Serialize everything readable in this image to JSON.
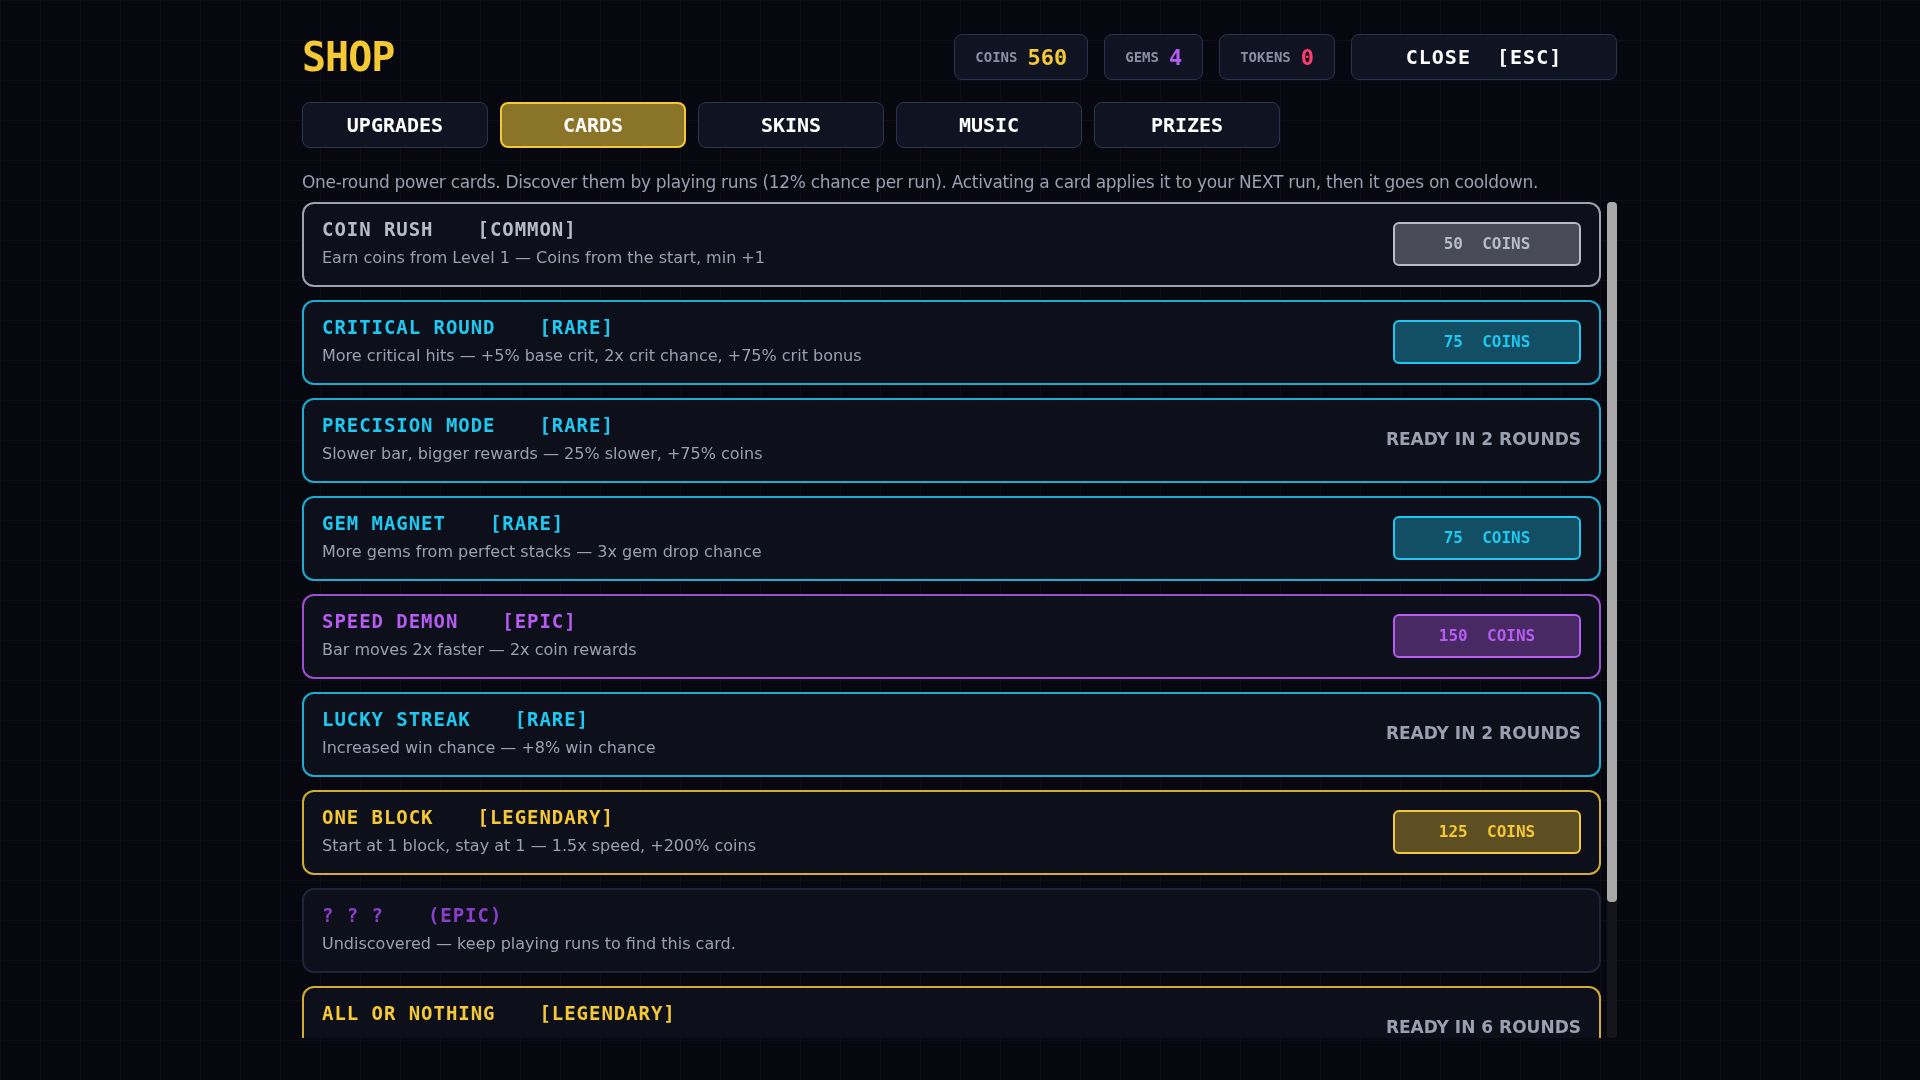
{
  "title": "SHOP",
  "currencies": [
    {
      "label": "COINS",
      "value": "560",
      "color": "#f5c935"
    },
    {
      "label": "GEMS",
      "value": "4",
      "color": "#b65cf0"
    },
    {
      "label": "TOKENS",
      "value": "0",
      "color": "#ff3b6b"
    }
  ],
  "close_button": "CLOSE  [ESC]",
  "tabs": [
    {
      "label": "UPGRADES",
      "selected": false
    },
    {
      "label": "CARDS",
      "selected": true
    },
    {
      "label": "SKINS",
      "selected": false
    },
    {
      "label": "MUSIC",
      "selected": false
    },
    {
      "label": "PRIZES",
      "selected": false
    }
  ],
  "intro": "One-round power cards. Discover them by playing runs (12% chance per run). Activating a card applies it to your NEXT run, then it goes on cooldown.",
  "cards": [
    {
      "name": "COIN RUSH",
      "tag": "[COMMON]",
      "description": "Earn coins from Level 1 — Coins from the start, min +1",
      "color": "#b8bcc8",
      "discovered": true,
      "action": {
        "kind": "buy",
        "label": "50  COINS"
      }
    },
    {
      "name": "CRITICAL ROUND",
      "tag": "[RARE]",
      "description": "More critical hits — +5% base crit, 2x crit chance, +75% crit bonus",
      "color": "#1ec8f0",
      "discovered": true,
      "action": {
        "kind": "buy",
        "label": "75  COINS"
      }
    },
    {
      "name": "PRECISION MODE",
      "tag": "[RARE]",
      "description": "Slower bar, bigger rewards — 25% slower, +75% coins",
      "color": "#1ec8f0",
      "discovered": true,
      "action": {
        "kind": "cooldown",
        "label": "READY IN 2 ROUNDS"
      }
    },
    {
      "name": "GEM MAGNET",
      "tag": "[RARE]",
      "description": "More gems from perfect stacks — 3x gem drop chance",
      "color": "#1ec8f0",
      "discovered": true,
      "action": {
        "kind": "buy",
        "label": "75  COINS"
      }
    },
    {
      "name": "SPEED DEMON",
      "tag": "[EPIC]",
      "description": "Bar moves 2x faster — 2x coin rewards",
      "color": "#b65cf0",
      "discovered": true,
      "action": {
        "kind": "buy",
        "label": "150  COINS"
      }
    },
    {
      "name": "LUCKY STREAK",
      "tag": "[RARE]",
      "description": "Increased win chance — +8% win chance",
      "color": "#1ec8f0",
      "discovered": true,
      "action": {
        "kind": "cooldown",
        "label": "READY IN 2 ROUNDS"
      }
    },
    {
      "name": "ONE BLOCK",
      "tag": "[LEGENDARY]",
      "description": "Start at 1 block, stay at 1 — 1.5x speed, +200% coins",
      "color": "#f5c935",
      "discovered": true,
      "action": {
        "kind": "buy",
        "label": "125  COINS"
      }
    },
    {
      "name": "? ? ?",
      "tag": "(EPIC)",
      "description": "Undiscovered — keep playing runs to find this card.",
      "color": "#8a3fc8",
      "discovered": false
    },
    {
      "name": "ALL OR NOTHING",
      "tag": "[LEGENDARY]",
      "color": "#f5c935",
      "discovered": true,
      "action": {
        "kind": "cooldown",
        "label": "READY IN 6 ROUNDS"
      }
    }
  ]
}
